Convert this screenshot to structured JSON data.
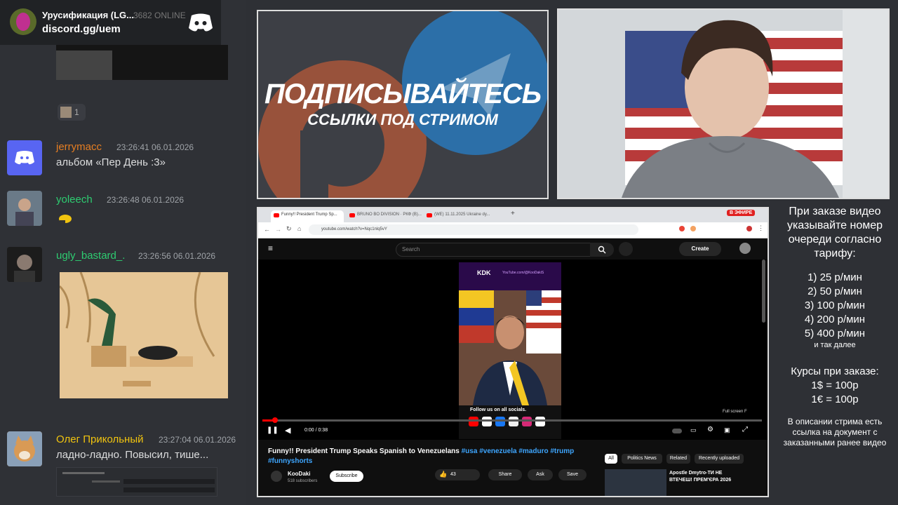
{
  "discord_widget": {
    "server_name": "Урусификация (LG...",
    "online": "3682 ONLINE",
    "invite": "discord.gg/uem"
  },
  "reaction": {
    "count": "1"
  },
  "messages": [
    {
      "user": "jerrymacc",
      "time": "23:26:41 06.01.2026",
      "text": "альбом «Пер День :3»",
      "color": "#e67e22"
    },
    {
      "user": "yoleech",
      "time": "23:26:48 06.01.2026",
      "text": "",
      "color": "#2ecc71"
    },
    {
      "user": "ugly_bastard_.",
      "time": "23:26:56 06.01.2026",
      "text": "",
      "color": "#2ecc71"
    },
    {
      "user": "Олег Прикольный",
      "time": "23:27:04 06.01.2026",
      "text": "ладно-ладно. Повысил, тише...",
      "color": "#f1c40f"
    }
  ],
  "subscribe_panel": {
    "headline": "ПОДПИСЫВАЙТЕСЬ",
    "subline": "ССЫЛКИ ПОД СТРИМОМ"
  },
  "browser": {
    "tabs": [
      "Funny!! President Trump Sp...",
      "BRUNO BO DIVISION · РКФ (B)...",
      "(WE) 11.11.2025 Ukraine dy..."
    ],
    "live_badge": "В ЭФИРЕ",
    "url": "youtube.com/watch?v=Nqc1nlq5vY",
    "search_placeholder": "Search",
    "create_label": "Create",
    "video": {
      "channel_banner": "YouTube.com/@KooDakiS",
      "kdk_label": "KDK",
      "follow_label": "Follow us on all socials.",
      "time": "0:00 / 0:38",
      "fullscreen_hint": "Full screen  F",
      "title": "Funny!! President Trump Speaks Spanish to Venezuelans",
      "hashtags": "#usa #venezuela #maduro #trump",
      "hashtags2": "#funnyshorts",
      "channel": "KooDaki",
      "subscribers": "518 subscribers",
      "subscribe": "Subscribe",
      "likes": "43",
      "share": "Share",
      "ask": "Ask",
      "save": "Save"
    },
    "chips": [
      "All",
      "Politics News",
      "Related",
      "Recently uploaded"
    ],
    "related_title": "Apostle Dmytro-ТИ НЕ",
    "related_title2": "ВТЕЧЕШ! ПРЕМ'ЄРА 2026"
  },
  "info": {
    "order_note": "При заказе видео указывайте номер очереди согласно тарифу:",
    "tariffs": [
      "1) 25 р/мин",
      "2) 50 р/мин",
      "3) 100 р/мин",
      "4) 200 р/мин",
      "5) 400 р/мин"
    ],
    "etc": "и так далее",
    "rates_title": "Курсы при заказе:",
    "rate_usd": "1$ = 100р",
    "rate_eur": "1€ = 100р",
    "description_note": "В описании стрима есть ссылка на документ с заказанными ранее видео"
  },
  "colors": {
    "discord_bg": "#2f3136",
    "yt_red": "#ff0000",
    "accent_blue": "#3ea6ff"
  }
}
